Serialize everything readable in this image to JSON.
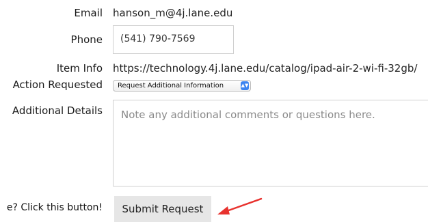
{
  "form": {
    "email": {
      "label": "Email",
      "value": "hanson_m@4j.lane.edu"
    },
    "phone": {
      "label": "Phone",
      "value": "(541) 790-7569"
    },
    "item_info": {
      "label": "Item Info",
      "value": "https://technology.4j.lane.edu/catalog/ipad-air-2-wi-fi-32gb/"
    },
    "action_requested": {
      "label": "Action Requested",
      "selected": "Request Additional Information"
    },
    "additional_details": {
      "label": "Additional Details",
      "placeholder": "Note any additional comments or questions here."
    },
    "hint": "e? Click this button!",
    "submit_label": "Submit Request"
  },
  "annotation": {
    "arrow_color": "#e8322e"
  }
}
